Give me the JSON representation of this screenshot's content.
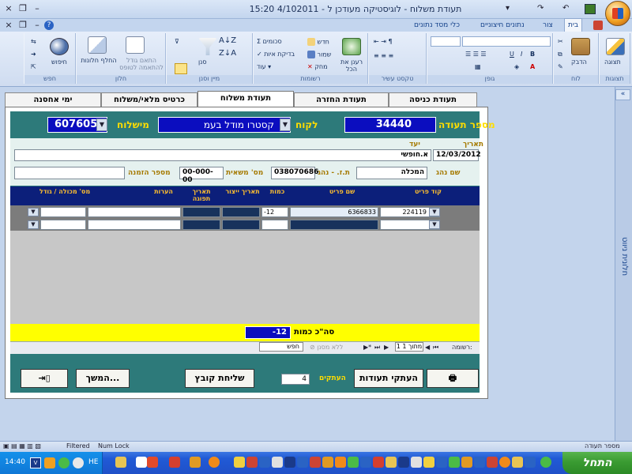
{
  "window": {
    "title": "תעודת משלוח - לוגיסטיקה מעודכן ל - 4/102011  15:20",
    "controls": [
      "×",
      "❐",
      "–"
    ],
    "inner_controls": [
      "×",
      "❐",
      "–"
    ],
    "qat": [
      "↶",
      "↷",
      "▾"
    ]
  },
  "ribbon": {
    "tabs": [
      "בית",
      "צור",
      "נתונים חיצוניים",
      "כלי מסד נתונים"
    ],
    "active_tab": "בית",
    "groups": {
      "views": {
        "label": "תצוגות",
        "button": "תצוגה"
      },
      "clipboard": {
        "label": "לוח",
        "button": "הדבק"
      },
      "font": {
        "label": "גופן"
      },
      "rich_text": {
        "label": "טקסט עשיר"
      },
      "records": {
        "label": "רשומות",
        "refresh": "רענן את הכל",
        "new": "חדש",
        "save": "שמור",
        "delete": "מחק",
        "totals": "סכומים",
        "spelling": "בדיקת איות",
        "more": "עוד"
      },
      "sort_filter": {
        "label": "מיין וסנן",
        "filter": "סנן"
      },
      "window": {
        "label": "חלון",
        "fit": "התאם גודל להתאמה לטופס",
        "switch": "החלף חלונות"
      },
      "find": {
        "label": "חפש",
        "find": "חיפוש"
      }
    }
  },
  "nav_pane": {
    "label": "חלונית ניווט",
    "toggle": "«"
  },
  "doc_tabs": [
    "תעודת כניסה",
    "תעודת החזרה",
    "תעודת משלוח",
    "כרטיס מלאי/משלוח",
    "ימי אחסנה"
  ],
  "active_doc_tab": "תעודת משלוח",
  "form": {
    "doc_number_label": "מספר תעודה",
    "doc_number": "34440",
    "customer_label": "לקוח",
    "customer": "קסטרו מודל בעמ",
    "shipment_label": "מישלוח",
    "shipment": "607605",
    "date_label": "תאריך",
    "date": "12/03/2012",
    "target_label": "יעד",
    "target": "א.חופשי",
    "driver_label": "שם נהג",
    "driver": "המכלה",
    "driver_id_label": "ת.ז. - נהג",
    "driver_id": "038070686",
    "truck_label": "מס' משאית",
    "truck": "00-000-00",
    "order_label": "מספר הזמנה",
    "order": ""
  },
  "grid": {
    "columns": [
      "קוד פריט",
      "שם פריט",
      "כמות",
      "תאריך ייצור",
      "תאריך תפוגה",
      "הערות",
      "מס' מכולה / גודל"
    ],
    "rows": [
      {
        "code": "224119",
        "name": "6366833",
        "qty": "-12",
        "prod": "",
        "exp": "",
        "notes": "",
        "container": ""
      },
      {
        "code": "",
        "name": "",
        "qty": "",
        "prod": "",
        "exp": "",
        "notes": "",
        "container": ""
      }
    ]
  },
  "totals": {
    "label": "סה\"כ כמות",
    "value": "-12"
  },
  "record_nav": {
    "label": "רשומה:",
    "position": "1 מתוך 1",
    "filter": "ללא מסנן",
    "search": "חפש"
  },
  "buttons": {
    "copies_label": "העתקים",
    "copies": "4",
    "copy_docs": "העתקי תעודות",
    "send_file": "שליחת קובץ",
    "continue": "המשך...",
    "print_icon": "printer-icon",
    "exit_icon": "exit-door-icon"
  },
  "status_bar": {
    "left": "מספר תעודה",
    "filtered": "Filtered",
    "numlock": "Num Lock"
  },
  "taskbar": {
    "start": "התחל",
    "clock": "14:40",
    "lang": "HE"
  },
  "colors": {
    "form_bg": "#2d7a7a",
    "field_blue": "#0b0dbf",
    "label_gold": "#ffdd00",
    "grid_header": "#0c1f7a",
    "totals_yellow": "#ffff00"
  }
}
